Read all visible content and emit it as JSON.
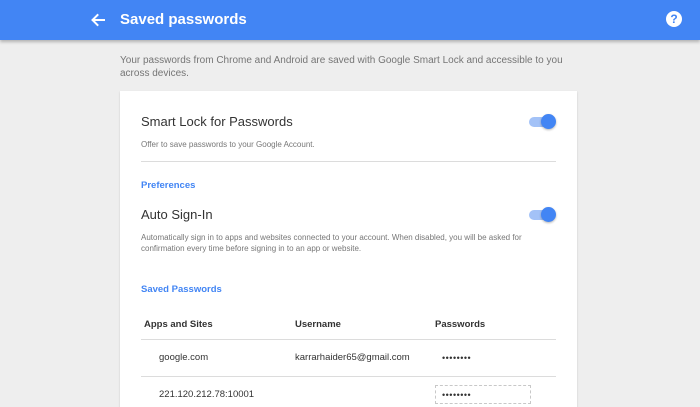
{
  "header": {
    "back_icon": "arrow-back-icon",
    "title": "Saved passwords",
    "help_icon": "help-icon",
    "help_glyph": "?"
  },
  "intro_text": "Your passwords from Chrome and Android are saved with Google Smart Lock and accessible to you across devices.",
  "smart_lock": {
    "title": "Smart Lock for Passwords",
    "description": "Offer to save passwords to your Google Account.",
    "enabled": true
  },
  "preferences": {
    "heading": "Preferences",
    "auto_sign_in": {
      "title": "Auto Sign-In",
      "description": "Automatically sign in to apps and websites connected to your account. When disabled, you will be asked for confirmation every time before signing in to an app or website.",
      "enabled": true
    }
  },
  "saved_passwords": {
    "heading": "Saved Passwords",
    "columns": [
      "Apps and Sites",
      "Username",
      "Passwords"
    ],
    "rows": [
      {
        "site": "google.com",
        "username": "karrarhaider65@gmail.com",
        "password": "••••••••"
      },
      {
        "site": "221.120.212.78:10001",
        "username": "",
        "password": "••••••••"
      }
    ]
  },
  "colors": {
    "appbar": "#4285f4",
    "accent": "#4285f4",
    "toggle_track": "#a3c2f7",
    "background": "#eeeeee"
  }
}
